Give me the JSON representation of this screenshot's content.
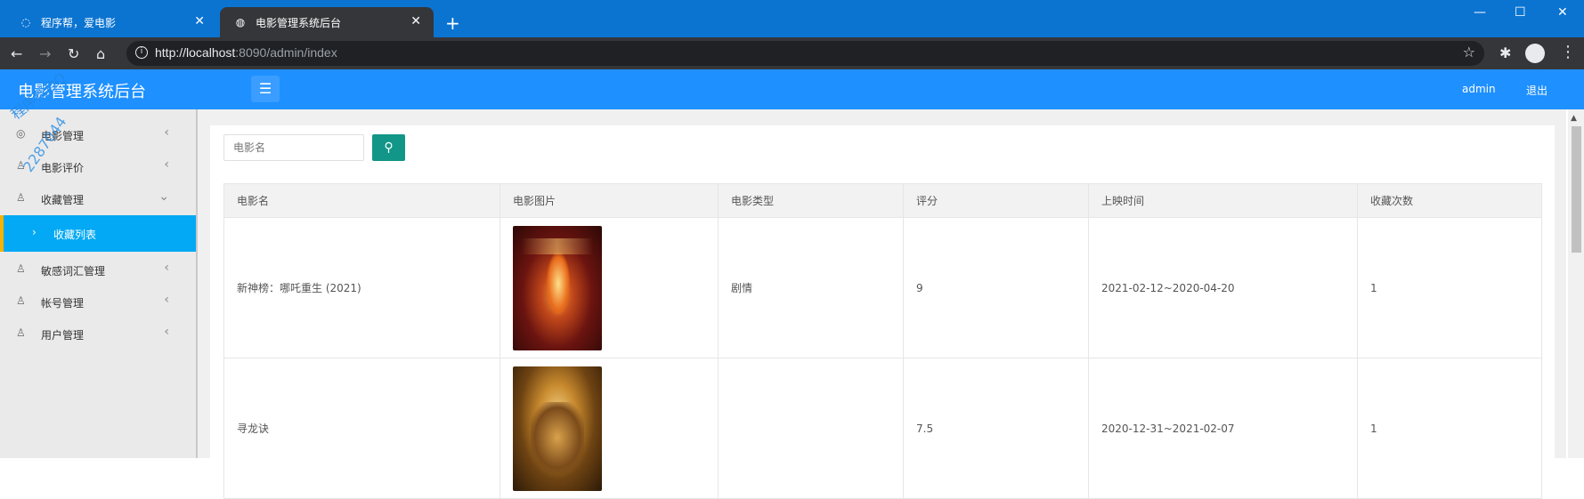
{
  "browser": {
    "tabs": [
      {
        "title": "程序帮，爱电影",
        "active": false
      },
      {
        "title": "电影管理系统后台",
        "active": true
      }
    ],
    "url_host": "http://localhost",
    "url_rest": ":8090/admin/index"
  },
  "header": {
    "title": "电影管理系统后台",
    "user": "admin",
    "logout": "退出"
  },
  "sidebar": {
    "items": [
      {
        "label": "电影管理",
        "icon": "movie-icon",
        "expanded": false
      },
      {
        "label": "电影评价",
        "icon": "user-icon",
        "expanded": false
      },
      {
        "label": "收藏管理",
        "icon": "user-icon",
        "expanded": true
      },
      {
        "label": "敏感词汇管理",
        "icon": "user-icon",
        "expanded": false
      },
      {
        "label": "帐号管理",
        "icon": "user-icon",
        "expanded": false
      },
      {
        "label": "用户管理",
        "icon": "user-icon",
        "expanded": false
      }
    ],
    "active_sub": "收藏列表",
    "watermark": "程序帮QQ",
    "watermark2": "2287044"
  },
  "search": {
    "placeholder": "电影名"
  },
  "table": {
    "columns": [
      "电影名",
      "电影图片",
      "电影类型",
      "评分",
      "上映时间",
      "收藏次数"
    ],
    "rows": [
      {
        "name": "新神榜：哪吒重生 (2021)",
        "type": "剧情",
        "score": "9",
        "date": "2021-02-12~2020-04-20",
        "count": "1"
      },
      {
        "name": "寻龙诀",
        "type": "",
        "score": "7.5",
        "date": "2020-12-31~2021-02-07",
        "count": "1"
      }
    ]
  },
  "colors": {
    "tabstrip": "#0b74d1",
    "header": "#1e90ff",
    "active_sub": "#03a9f4",
    "search_button": "#129688"
  }
}
